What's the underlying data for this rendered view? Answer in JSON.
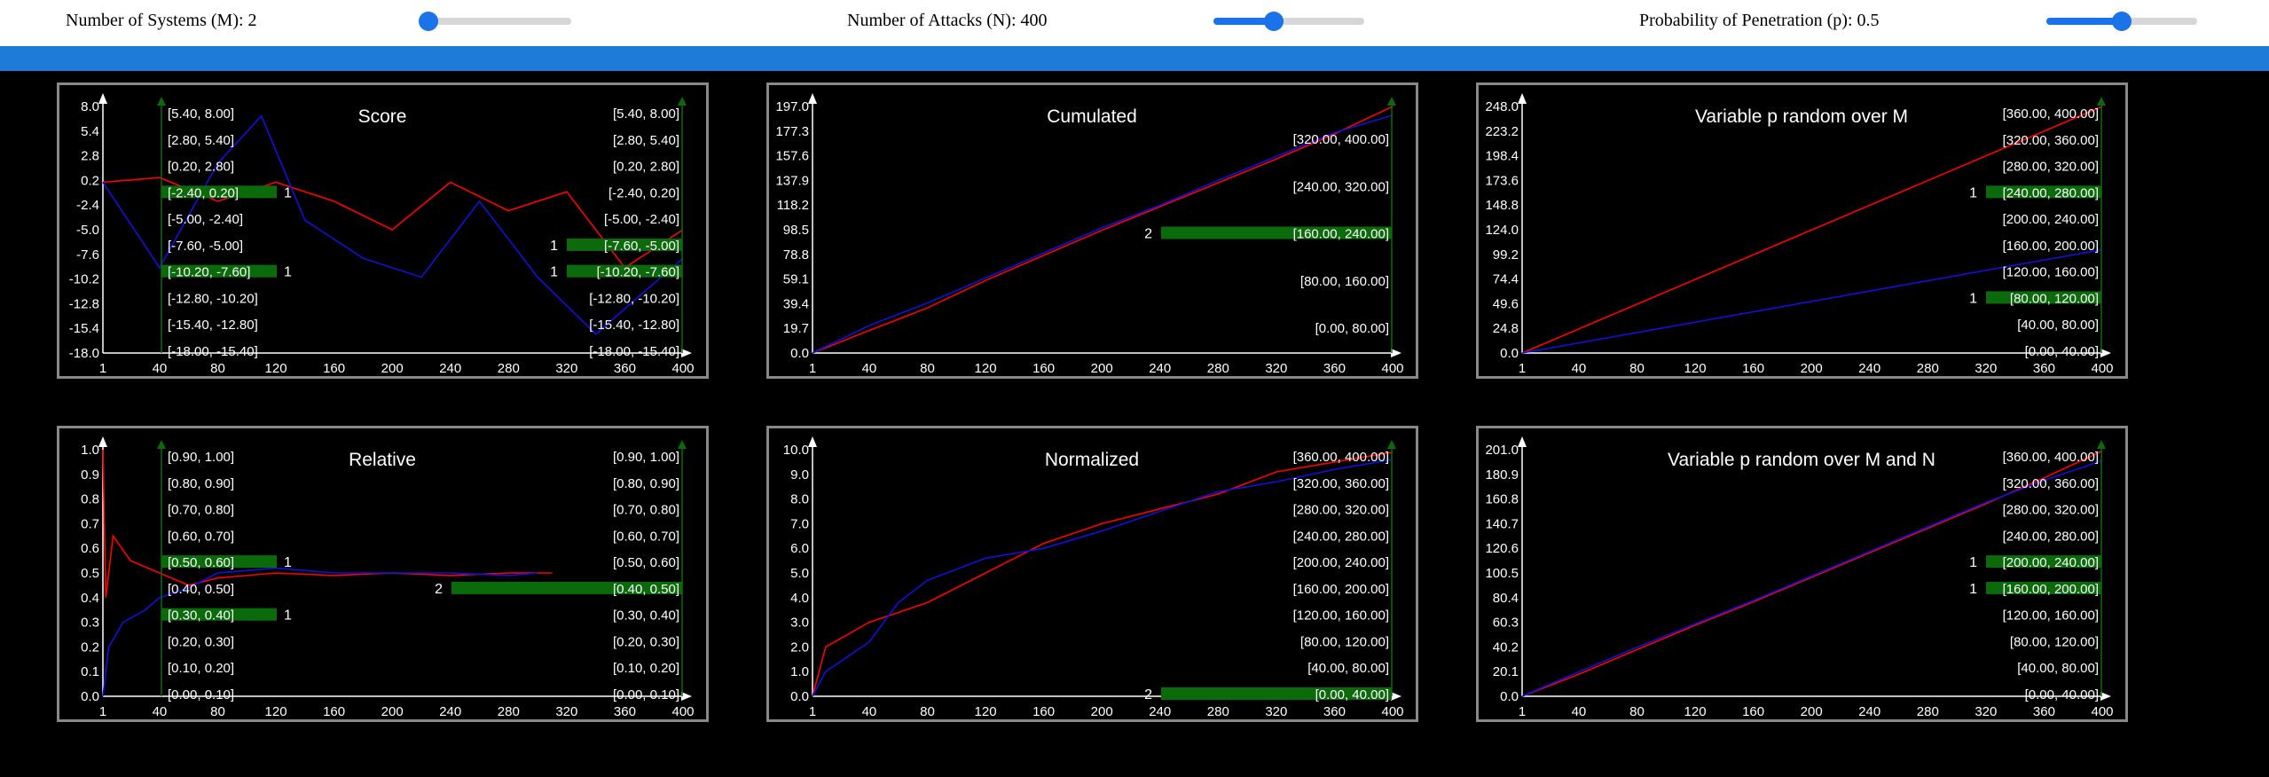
{
  "controls": {
    "systems": {
      "label": "Number of Systems (M): 2",
      "value": 2,
      "min": 1,
      "max": 20
    },
    "attacks": {
      "label": "Number of Attacks (N): 400",
      "value": 400,
      "min": 0,
      "max": 1000
    },
    "probability": {
      "label": "Probability of Penetration (p): 0.5",
      "value": 0.5,
      "min": 0,
      "max": 1
    }
  },
  "colors": {
    "series1": "#ff0000",
    "series2": "#1010e0",
    "histogram": "#0b6b0b",
    "background": "#000000",
    "border": "#888888",
    "accent": "#1a73e8"
  },
  "chart_data": [
    {
      "id": "score",
      "type": "line",
      "title": "Score",
      "xticks": [
        "1",
        "40",
        "80",
        "120",
        "160",
        "200",
        "240",
        "280",
        "320",
        "360",
        "400"
      ],
      "ytick_labels": [
        "8.0",
        "5.4",
        "2.8",
        "0.2",
        "-2.4",
        "-5.0",
        "-7.6",
        "-10.2",
        "-12.8",
        "-15.4",
        "-18.0"
      ],
      "xlim": [
        1,
        400
      ],
      "ylim": [
        -18.0,
        8.0
      ],
      "series": [
        {
          "color": "red",
          "points": [
            [
              1,
              0
            ],
            [
              40,
              0.5
            ],
            [
              80,
              -2
            ],
            [
              120,
              0
            ],
            [
              160,
              -2
            ],
            [
              200,
              -5
            ],
            [
              240,
              0
            ],
            [
              280,
              -3
            ],
            [
              320,
              -1
            ],
            [
              360,
              -9
            ],
            [
              400,
              -5
            ]
          ]
        },
        {
          "color": "blue",
          "points": [
            [
              1,
              0
            ],
            [
              40,
              -9
            ],
            [
              80,
              2
            ],
            [
              110,
              7
            ],
            [
              140,
              -4
            ],
            [
              180,
              -8
            ],
            [
              220,
              -10
            ],
            [
              260,
              -2
            ],
            [
              300,
              -10
            ],
            [
              340,
              -16
            ],
            [
              400,
              -8
            ]
          ]
        }
      ],
      "bins_left": [
        "[5.40, 8.00]",
        "[2.80, 5.40]",
        "[0.20, 2.80]",
        "[-2.40, 0.20]",
        "[-5.00, -2.40]",
        "[-7.60, -5.00]",
        "[-10.20, -7.60]",
        "[-12.80, -10.20]",
        "[-15.40, -12.80]",
        "[-18.00, -15.40]"
      ],
      "counts_left": [
        0,
        0,
        0,
        1,
        0,
        0,
        1,
        0,
        0,
        0
      ],
      "bins_right": [
        "[5.40, 8.00]",
        "[2.80, 5.40]",
        "[0.20, 2.80]",
        "[-2.40, 0.20]",
        "[-5.00, -2.40]",
        "[-7.60, -5.00]",
        "[-10.20, -7.60]",
        "[-12.80, -10.20]",
        "[-15.40, -12.80]",
        "[-18.00, -15.40]"
      ],
      "counts_right": [
        0,
        0,
        0,
        0,
        0,
        1,
        1,
        0,
        0,
        0
      ]
    },
    {
      "id": "cumulated",
      "type": "line",
      "title": "Cumulated",
      "xticks": [
        "1",
        "40",
        "80",
        "120",
        "160",
        "200",
        "240",
        "280",
        "320",
        "360",
        "400"
      ],
      "ytick_labels": [
        "197.0",
        "177.3",
        "157.6",
        "137.9",
        "118.2",
        "98.5",
        "78.8",
        "59.1",
        "39.4",
        "19.7",
        "0.0"
      ],
      "xlim": [
        1,
        400
      ],
      "ylim": [
        0,
        197.0
      ],
      "series": [
        {
          "color": "red",
          "points": [
            [
              1,
              0
            ],
            [
              40,
              18
            ],
            [
              80,
              36
            ],
            [
              120,
              58
            ],
            [
              160,
              78
            ],
            [
              200,
              98
            ],
            [
              240,
              117
            ],
            [
              280,
              136
            ],
            [
              320,
              155
            ],
            [
              360,
              175
            ],
            [
              400,
              197
            ]
          ]
        },
        {
          "color": "blue",
          "points": [
            [
              1,
              0
            ],
            [
              40,
              22
            ],
            [
              80,
              40
            ],
            [
              120,
              60
            ],
            [
              160,
              80
            ],
            [
              200,
              100
            ],
            [
              240,
              118
            ],
            [
              280,
              138
            ],
            [
              320,
              157
            ],
            [
              360,
              176
            ],
            [
              400,
              190
            ]
          ]
        }
      ],
      "bins_left": [],
      "counts_left": [],
      "bins_right": [
        "[320.00, 400.00]",
        "[240.00, 320.00]",
        "[160.00, 240.00]",
        "[80.00, 160.00]",
        "[0.00, 80.00]"
      ],
      "counts_right": [
        0,
        0,
        2,
        0,
        0
      ]
    },
    {
      "id": "variable-m",
      "type": "line",
      "title": "Variable p random over M",
      "xticks": [
        "1",
        "40",
        "80",
        "120",
        "160",
        "200",
        "240",
        "280",
        "320",
        "360",
        "400"
      ],
      "ytick_labels": [
        "248.0",
        "223.2",
        "198.4",
        "173.6",
        "148.8",
        "124.0",
        "99.2",
        "74.4",
        "49.6",
        "24.8",
        "0.0"
      ],
      "xlim": [
        1,
        400
      ],
      "ylim": [
        0,
        248.0
      ],
      "series": [
        {
          "color": "red",
          "points": [
            [
              1,
              0
            ],
            [
              400,
              248
            ]
          ]
        },
        {
          "color": "blue",
          "points": [
            [
              1,
              0
            ],
            [
              400,
              104
            ]
          ]
        }
      ],
      "bins_left": [],
      "counts_left": [],
      "bins_right": [
        "[360.00, 400.00]",
        "[320.00, 360.00]",
        "[280.00, 320.00]",
        "[240.00, 280.00]",
        "[200.00, 240.00]",
        "[160.00, 200.00]",
        "[120.00, 160.00]",
        "[80.00, 120.00]",
        "[40.00, 80.00]",
        "[0.00, 40.00]"
      ],
      "counts_right": [
        0,
        0,
        0,
        1,
        0,
        0,
        0,
        1,
        0,
        0
      ]
    },
    {
      "id": "relative",
      "type": "line",
      "title": "Relative",
      "xticks": [
        "1",
        "40",
        "80",
        "120",
        "160",
        "200",
        "240",
        "280",
        "320",
        "360",
        "400"
      ],
      "ytick_labels": [
        "1.0",
        "0.9",
        "0.8",
        "0.7",
        "0.6",
        "0.5",
        "0.4",
        "0.3",
        "0.2",
        "0.1",
        "0.0"
      ],
      "xlim": [
        1,
        400
      ],
      "ylim": [
        0,
        1.0
      ],
      "series": [
        {
          "color": "red",
          "points": [
            [
              1,
              1.0
            ],
            [
              3,
              0.4
            ],
            [
              8,
              0.65
            ],
            [
              20,
              0.55
            ],
            [
              40,
              0.5
            ],
            [
              60,
              0.45
            ],
            [
              80,
              0.48
            ],
            [
              120,
              0.5
            ],
            [
              160,
              0.49
            ],
            [
              200,
              0.5
            ],
            [
              240,
              0.49
            ],
            [
              280,
              0.5
            ],
            [
              310,
              0.5
            ]
          ]
        },
        {
          "color": "blue",
          "points": [
            [
              1,
              0
            ],
            [
              5,
              0.2
            ],
            [
              15,
              0.3
            ],
            [
              30,
              0.35
            ],
            [
              40,
              0.4
            ],
            [
              60,
              0.44
            ],
            [
              80,
              0.5
            ],
            [
              120,
              0.52
            ],
            [
              160,
              0.5
            ],
            [
              200,
              0.5
            ],
            [
              240,
              0.5
            ],
            [
              280,
              0.49
            ],
            [
              300,
              0.5
            ]
          ]
        }
      ],
      "bins_left": [
        "[0.90, 1.00]",
        "[0.80, 0.90]",
        "[0.70, 0.80]",
        "[0.60, 0.70]",
        "[0.50, 0.60]",
        "[0.40, 0.50]",
        "[0.30, 0.40]",
        "[0.20, 0.30]",
        "[0.10, 0.20]",
        "[0.00, 0.10]"
      ],
      "counts_left": [
        0,
        0,
        0,
        0,
        1,
        0,
        1,
        0,
        0,
        0
      ],
      "bins_right": [
        "[0.90, 1.00]",
        "[0.80, 0.90]",
        "[0.70, 0.80]",
        "[0.60, 0.70]",
        "[0.50, 0.60]",
        "[0.40, 0.50]",
        "[0.30, 0.40]",
        "[0.20, 0.30]",
        "[0.10, 0.20]",
        "[0.00, 0.10]"
      ],
      "counts_right": [
        0,
        0,
        0,
        0,
        0,
        2,
        0,
        0,
        0,
        0
      ]
    },
    {
      "id": "normalized",
      "type": "line",
      "title": "Normalized",
      "xticks": [
        "1",
        "40",
        "80",
        "120",
        "160",
        "200",
        "240",
        "280",
        "320",
        "360",
        "400"
      ],
      "ytick_labels": [
        "10.0",
        "9.0",
        "8.0",
        "7.0",
        "6.0",
        "5.0",
        "4.0",
        "3.0",
        "2.0",
        "1.0",
        "0.0"
      ],
      "xlim": [
        1,
        400
      ],
      "ylim": [
        0,
        10.0
      ],
      "series": [
        {
          "color": "red",
          "points": [
            [
              1,
              0
            ],
            [
              10,
              2
            ],
            [
              40,
              3
            ],
            [
              80,
              3.8
            ],
            [
              120,
              5
            ],
            [
              160,
              6.2
            ],
            [
              200,
              7
            ],
            [
              240,
              7.6
            ],
            [
              280,
              8.2
            ],
            [
              320,
              9.1
            ],
            [
              360,
              9.5
            ],
            [
              400,
              9.9
            ]
          ]
        },
        {
          "color": "blue",
          "points": [
            [
              1,
              0
            ],
            [
              10,
              1
            ],
            [
              40,
              2.2
            ],
            [
              60,
              3.8
            ],
            [
              80,
              4.7
            ],
            [
              120,
              5.6
            ],
            [
              160,
              6
            ],
            [
              200,
              6.7
            ],
            [
              240,
              7.5
            ],
            [
              280,
              8.3
            ],
            [
              320,
              8.7
            ],
            [
              360,
              9.2
            ],
            [
              400,
              9.6
            ]
          ]
        }
      ],
      "bins_left": [],
      "counts_left": [],
      "bins_right": [
        "[360.00, 400.00]",
        "[320.00, 360.00]",
        "[280.00, 320.00]",
        "[240.00, 280.00]",
        "[200.00, 240.00]",
        "[160.00, 200.00]",
        "[120.00, 160.00]",
        "[80.00, 120.00]",
        "[40.00, 80.00]",
        "[0.00, 40.00]"
      ],
      "counts_right": [
        0,
        0,
        0,
        0,
        0,
        0,
        0,
        0,
        0,
        2
      ]
    },
    {
      "id": "variable-mn",
      "type": "line",
      "title": "Variable p random over M and N",
      "xticks": [
        "1",
        "40",
        "80",
        "120",
        "160",
        "200",
        "240",
        "280",
        "320",
        "360",
        "400"
      ],
      "ytick_labels": [
        "201.0",
        "180.9",
        "160.8",
        "140.7",
        "120.6",
        "100.5",
        "80.4",
        "60.3",
        "40.2",
        "20.1",
        "0.0"
      ],
      "xlim": [
        1,
        400
      ],
      "ylim": [
        0,
        201.0
      ],
      "series": [
        {
          "color": "red",
          "points": [
            [
              1,
              0
            ],
            [
              40,
              18
            ],
            [
              80,
              38
            ],
            [
              120,
              58
            ],
            [
              160,
              77
            ],
            [
              200,
              97
            ],
            [
              240,
              117
            ],
            [
              280,
              137
            ],
            [
              320,
              157
            ],
            [
              360,
              178
            ],
            [
              400,
              200
            ]
          ]
        },
        {
          "color": "blue",
          "points": [
            [
              1,
              0
            ],
            [
              40,
              20
            ],
            [
              80,
              40
            ],
            [
              120,
              59
            ],
            [
              160,
              78
            ],
            [
              200,
              98
            ],
            [
              240,
              118
            ],
            [
              280,
              138
            ],
            [
              320,
              158
            ],
            [
              360,
              176
            ],
            [
              400,
              192
            ]
          ]
        }
      ],
      "bins_left": [],
      "counts_left": [],
      "bins_right": [
        "[360.00, 400.00]",
        "[320.00, 360.00]",
        "[280.00, 320.00]",
        "[240.00, 280.00]",
        "[200.00, 240.00]",
        "[160.00, 200.00]",
        "[120.00, 160.00]",
        "[80.00, 120.00]",
        "[40.00, 80.00]",
        "[0.00, 40.00]"
      ],
      "counts_right": [
        0,
        0,
        0,
        0,
        1,
        1,
        0,
        0,
        0,
        0
      ]
    }
  ]
}
